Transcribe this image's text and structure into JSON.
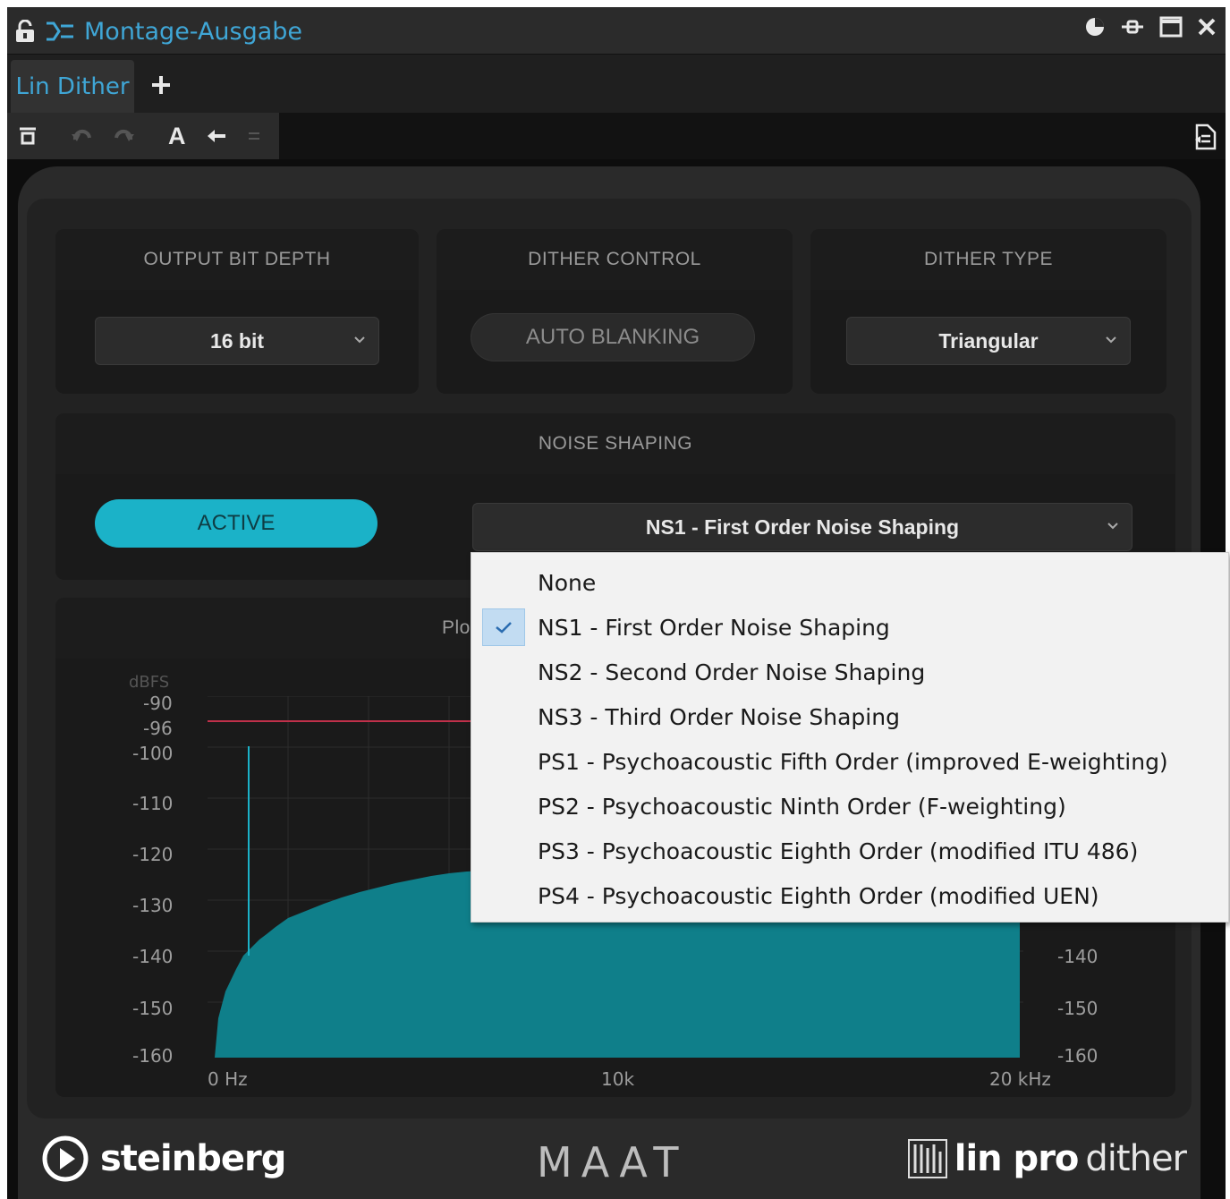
{
  "window": {
    "title": "Montage-Ausgabe"
  },
  "tabs": [
    {
      "label": "Lin Dither",
      "active": true
    }
  ],
  "toolbar": {
    "font_button_label": "A"
  },
  "panels": {
    "output_bit_depth": {
      "header": "OUTPUT BIT DEPTH",
      "value": "16 bit"
    },
    "dither_control": {
      "header": "DITHER CONTROL",
      "button_label": "AUTO BLANKING"
    },
    "dither_type": {
      "header": "DITHER TYPE",
      "value": "Triangular"
    },
    "noise_shaping": {
      "header": "NOISE SHAPING",
      "active_label": "ACTIVE",
      "value": "NS1 - First Order Noise Shaping"
    }
  },
  "plot": {
    "header_partial": "Plo",
    "unit_label": "dBFS",
    "y_ticks_left": [
      "-90",
      "-96",
      "-100",
      "-110",
      "-120",
      "-130",
      "-140",
      "-150",
      "-160"
    ],
    "y_ticks_right": [
      "-140",
      "-150",
      "-160"
    ],
    "x_ticks": [
      "0 Hz",
      "10k",
      "20 kHz"
    ],
    "reference_line_db": -96,
    "peak_x_hz": 1000
  },
  "dropdown_menu": {
    "selected_index": 1,
    "items": [
      "None",
      "NS1 - First Order Noise Shaping",
      "NS2 - Second Order Noise Shaping",
      "NS3 - Third Order Noise Shaping",
      "PS1 - Psychoacoustic Fifth Order (improved E-weighting)",
      "PS2 - Psychoacoustic Ninth Order (F-weighting)",
      "PS3 - Psychoacoustic Eighth Order (modified ITU 486)",
      "PS4 - Psychoacoustic Eighth Order (modified UEN)"
    ]
  },
  "branding": {
    "left": "steinberg",
    "center": "MAAT",
    "right_bold": "lin pro",
    "right_regular": "dither"
  },
  "colors": {
    "accent_teal": "#1bb2c8",
    "spectrum_fill": "#0f7f8a",
    "reference_line": "#c0304a",
    "title_blue": "#3fa6d6"
  }
}
